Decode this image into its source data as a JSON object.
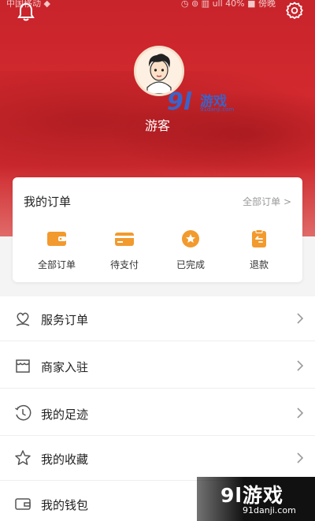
{
  "status_bar": {
    "carrier": "中国移动 ◆",
    "right": "◷ ⊚ ▥ ull 40% ■ 傍晚"
  },
  "profile": {
    "username": "游客"
  },
  "watermark_small": {
    "brand": "游戏",
    "url": "91danji.com"
  },
  "orders": {
    "title": "我的订单",
    "view_all": "全部订单 >",
    "items": [
      {
        "label": "全部订单",
        "icon": "wallet-icon"
      },
      {
        "label": "待支付",
        "icon": "card-icon"
      },
      {
        "label": "已完成",
        "icon": "badge-icon"
      },
      {
        "label": "退款",
        "icon": "refund-icon"
      }
    ]
  },
  "menu": {
    "items": [
      {
        "label": "服务订单",
        "icon": "heart-hand-icon"
      },
      {
        "label": "商家入驻",
        "icon": "store-icon"
      },
      {
        "label": "我的足迹",
        "icon": "clock-icon"
      },
      {
        "label": "我的收藏",
        "icon": "star-icon"
      },
      {
        "label": "我的钱包",
        "icon": "wallet-outline-icon"
      }
    ]
  },
  "watermark_big": {
    "brand": "9l游戏",
    "url": "91danji.com"
  },
  "colors": {
    "accent": "#cf2a2f",
    "order_icon": "#f29a2e"
  }
}
